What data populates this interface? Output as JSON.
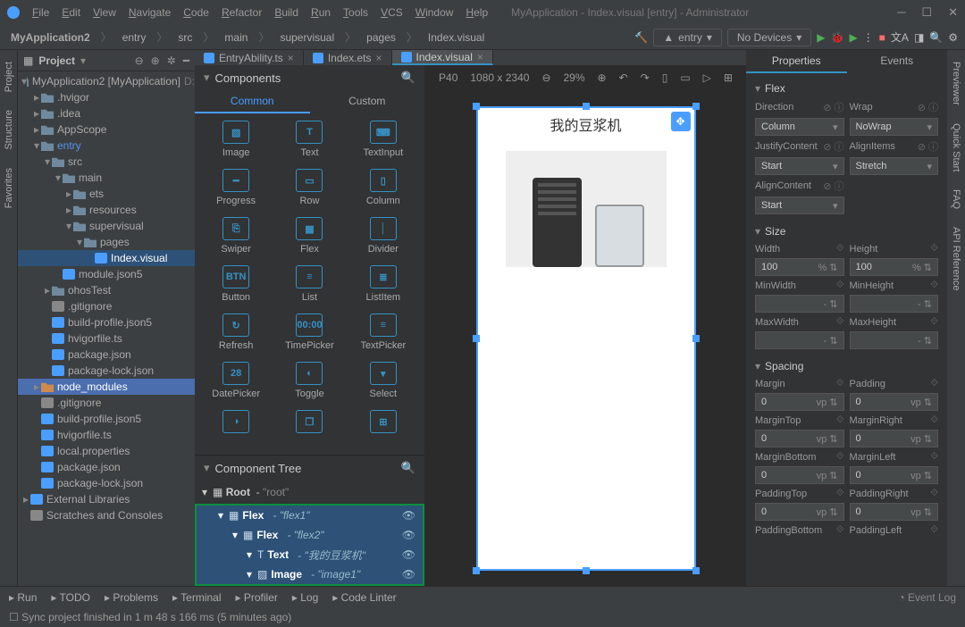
{
  "titlebar": {
    "menus": [
      "File",
      "Edit",
      "View",
      "Navigate",
      "Code",
      "Refactor",
      "Build",
      "Run",
      "Tools",
      "VCS",
      "Window",
      "Help"
    ],
    "title": "MyApplication - Index.visual [entry] - Administrator"
  },
  "breadcrumb": [
    "MyApplication2",
    "entry",
    "src",
    "main",
    "supervisual",
    "pages",
    "Index.visual"
  ],
  "toolbar": {
    "hammer": "⚒",
    "entry_combo": "entry",
    "devices_combo": "No Devices"
  },
  "project_panel": {
    "label": "Project",
    "tree": [
      {
        "d": 0,
        "a": "▾",
        "ic": "fold",
        "t": "MyApplication2 [MyApplication]",
        "suf": "D:"
      },
      {
        "d": 1,
        "a": "▸",
        "ic": "fold",
        "t": ".hvigor"
      },
      {
        "d": 1,
        "a": "▸",
        "ic": "fold",
        "t": ".idea"
      },
      {
        "d": 1,
        "a": "▸",
        "ic": "fold",
        "t": "AppScope"
      },
      {
        "d": 1,
        "a": "▾",
        "ic": "fold",
        "t": "entry",
        "blue": true
      },
      {
        "d": 2,
        "a": "▾",
        "ic": "fold",
        "t": "src"
      },
      {
        "d": 3,
        "a": "▾",
        "ic": "fold",
        "t": "main"
      },
      {
        "d": 4,
        "a": "▸",
        "ic": "fold",
        "t": "ets"
      },
      {
        "d": 4,
        "a": "▸",
        "ic": "fold",
        "t": "resources"
      },
      {
        "d": 4,
        "a": "▾",
        "ic": "fold",
        "t": "supervisual"
      },
      {
        "d": 5,
        "a": "▾",
        "ic": "fold",
        "t": "pages",
        "sel": false
      },
      {
        "d": 6,
        "a": "",
        "ic": "file-b",
        "t": "Index.visual",
        "sel": true
      },
      {
        "d": 3,
        "a": "",
        "ic": "file-b",
        "t": "module.json5"
      },
      {
        "d": 2,
        "a": "▸",
        "ic": "fold",
        "t": "ohosTest"
      },
      {
        "d": 2,
        "a": "",
        "ic": "file-g",
        "t": ".gitignore"
      },
      {
        "d": 2,
        "a": "",
        "ic": "file-b",
        "t": "build-profile.json5"
      },
      {
        "d": 2,
        "a": "",
        "ic": "file-b",
        "t": "hvigorfile.ts"
      },
      {
        "d": 2,
        "a": "",
        "ic": "file-b",
        "t": "package.json"
      },
      {
        "d": 2,
        "a": "",
        "ic": "file-b",
        "t": "package-lock.json"
      },
      {
        "d": 1,
        "a": "▸",
        "ic": "fold-o",
        "t": "node_modules",
        "hover": true
      },
      {
        "d": 1,
        "a": "",
        "ic": "file-g",
        "t": ".gitignore"
      },
      {
        "d": 1,
        "a": "",
        "ic": "file-b",
        "t": "build-profile.json5"
      },
      {
        "d": 1,
        "a": "",
        "ic": "file-b",
        "t": "hvigorfile.ts"
      },
      {
        "d": 1,
        "a": "",
        "ic": "file-b",
        "t": "local.properties"
      },
      {
        "d": 1,
        "a": "",
        "ic": "file-b",
        "t": "package.json"
      },
      {
        "d": 1,
        "a": "",
        "ic": "file-b",
        "t": "package-lock.json"
      },
      {
        "d": 0,
        "a": "▸",
        "ic": "file-b",
        "t": "External Libraries"
      },
      {
        "d": 0,
        "a": "",
        "ic": "file-g",
        "t": "Scratches and Consoles"
      }
    ]
  },
  "editor_tabs": [
    {
      "label": "EntryAbility.ts",
      "active": false
    },
    {
      "label": "Index.ets",
      "active": false
    },
    {
      "label": "Index.visual",
      "active": true
    }
  ],
  "components": {
    "title": "Components",
    "subtabs": [
      "Common",
      "Custom"
    ],
    "items": [
      {
        "i": "▨",
        "l": "Image"
      },
      {
        "i": "T",
        "l": "Text"
      },
      {
        "i": "⌨",
        "l": "TextInput"
      },
      {
        "i": "━",
        "l": "Progress"
      },
      {
        "i": "▭",
        "l": "Row"
      },
      {
        "i": "▯",
        "l": "Column"
      },
      {
        "i": "⎘",
        "l": "Swiper"
      },
      {
        "i": "▦",
        "l": "Flex"
      },
      {
        "i": "│",
        "l": "Divider"
      },
      {
        "i": "BTN",
        "l": "Button"
      },
      {
        "i": "≡",
        "l": "List"
      },
      {
        "i": "≣",
        "l": "ListItem"
      },
      {
        "i": "↻",
        "l": "Refresh"
      },
      {
        "i": "00:00",
        "l": "TimePicker"
      },
      {
        "i": "≡",
        "l": "TextPicker"
      },
      {
        "i": "28",
        "l": "DatePicker"
      },
      {
        "i": "◐",
        "l": "Toggle"
      },
      {
        "i": "▾",
        "l": "Select"
      },
      {
        "i": "◑",
        "l": ""
      },
      {
        "i": "❐",
        "l": ""
      },
      {
        "i": "⊞",
        "l": ""
      }
    ]
  },
  "component_tree": {
    "title": "Component Tree",
    "root": {
      "name": "Root",
      "sub": "\"root\""
    },
    "items": [
      {
        "d": 1,
        "name": "Flex",
        "sub": "\"flex1\""
      },
      {
        "d": 2,
        "name": "Flex",
        "sub": "\"flex2\""
      },
      {
        "d": 3,
        "name": "Text",
        "sub": "\"我的豆浆机\"",
        "icon": "T"
      },
      {
        "d": 3,
        "name": "Image",
        "sub": "\"image1\"",
        "icon": "▨"
      }
    ]
  },
  "canvas": {
    "device": "P40",
    "resolution": "1080 x 2340",
    "zoom": "29%",
    "content_title": "我的豆浆机"
  },
  "properties": {
    "tabs": [
      "Properties",
      "Events"
    ],
    "flex": {
      "title": "Flex",
      "direction_lbl": "Direction",
      "direction_val": "Column",
      "wrap_lbl": "Wrap",
      "wrap_val": "NoWrap",
      "justify_lbl": "JustifyContent",
      "justify_val": "Start",
      "align_lbl": "AlignItems",
      "align_val": "Stretch",
      "alignc_lbl": "AlignContent",
      "alignc_val": "Start"
    },
    "size": {
      "title": "Size",
      "width_lbl": "Width",
      "width_val": "100",
      "width_unit": "%",
      "height_lbl": "Height",
      "height_val": "100",
      "height_unit": "%",
      "minw_lbl": "MinWidth",
      "minw_val": "",
      "minh_lbl": "MinHeight",
      "minh_val": "",
      "maxw_lbl": "MaxWidth",
      "maxw_val": "",
      "maxh_lbl": "MaxHeight",
      "maxh_val": "",
      "dash": "-"
    },
    "spacing": {
      "title": "Spacing",
      "margin_lbl": "Margin",
      "margin_val": "0",
      "padding_lbl": "Padding",
      "padding_val": "0",
      "mt_lbl": "MarginTop",
      "mt_val": "0",
      "mr_lbl": "MarginRight",
      "mr_val": "0",
      "mb_lbl": "MarginBottom",
      "mb_val": "0",
      "ml_lbl": "MarginLeft",
      "ml_val": "0",
      "pt_lbl": "PaddingTop",
      "pt_val": "0",
      "pr_lbl": "PaddingRight",
      "pr_val": "0",
      "pb_lbl": "PaddingBottom",
      "pl_lbl": "PaddingLeft",
      "unit": "vp"
    }
  },
  "bottom_tabs": [
    "Run",
    "TODO",
    "Problems",
    "Terminal",
    "Profiler",
    "Log",
    "Code Linter"
  ],
  "event_log": "Event Log",
  "status": "Sync project finished in 1 m 48 s 166 ms (5 minutes ago)",
  "side_left": [
    "Project",
    "Structure",
    "Favorites"
  ],
  "side_right": [
    "Previewer",
    "Quick Start",
    "FAQ",
    "API Reference"
  ]
}
